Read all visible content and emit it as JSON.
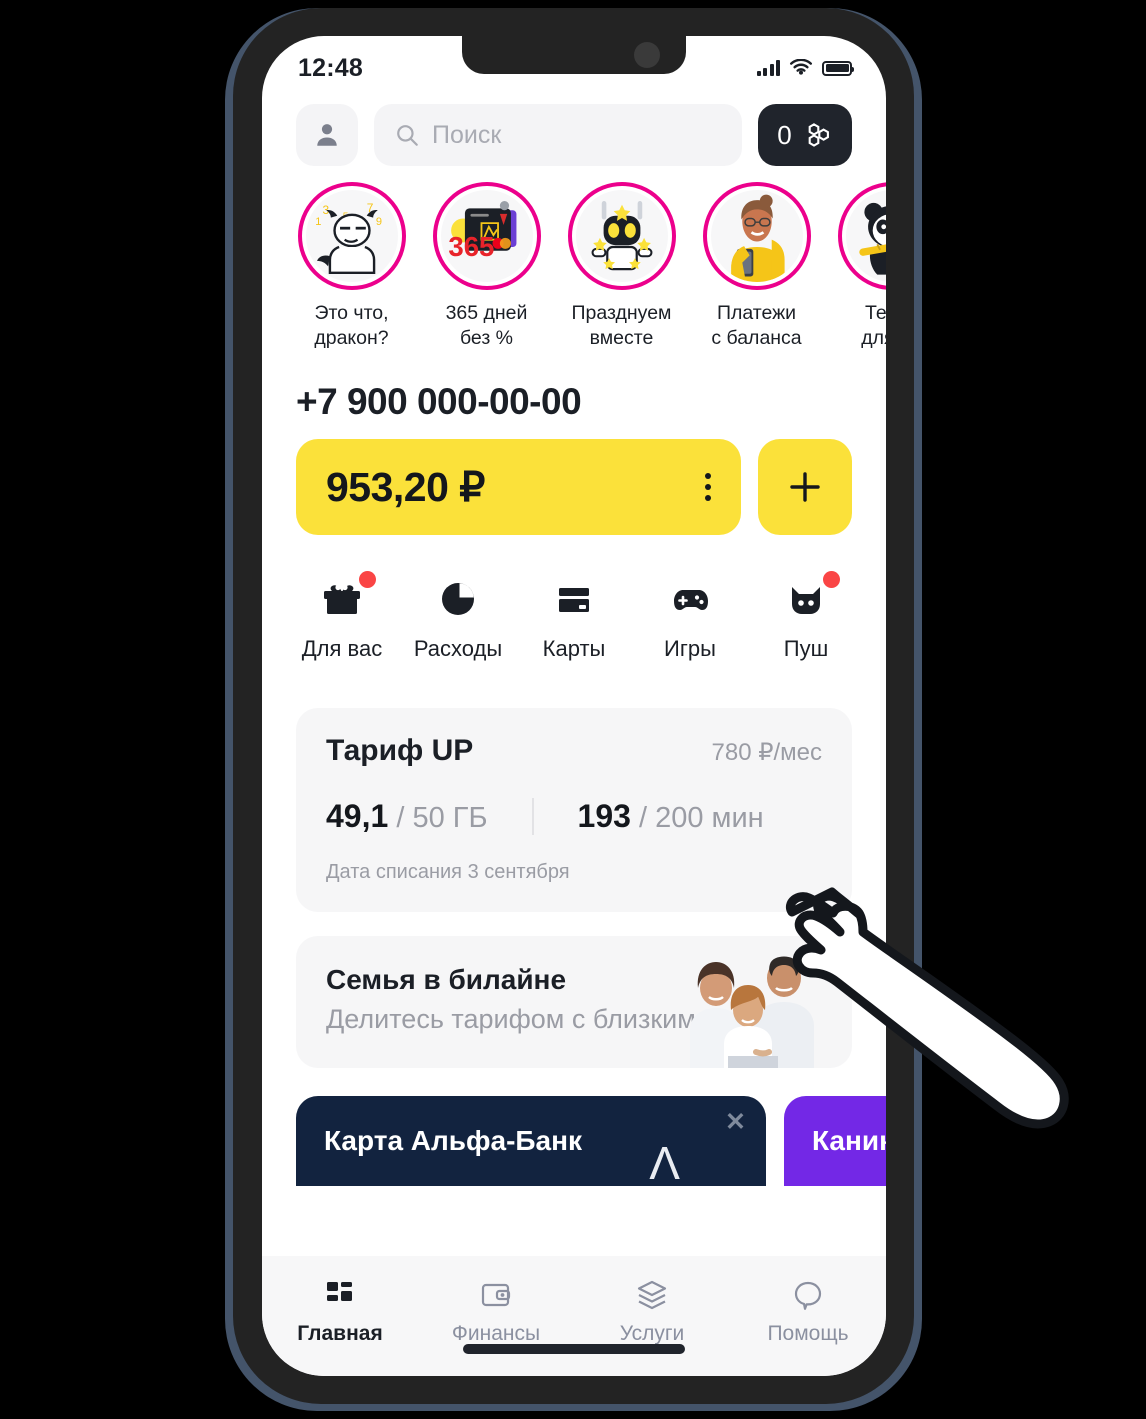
{
  "status_bar": {
    "time": "12:48",
    "signal_icon": "cellular-bars-icon",
    "wifi_icon": "wifi-icon",
    "battery_icon": "battery-icon"
  },
  "header": {
    "avatar_icon": "person-icon",
    "search": {
      "placeholder": "Поиск",
      "value": "",
      "icon": "search-icon"
    },
    "beads": {
      "count": "0",
      "icon": "honeycomb-icon"
    }
  },
  "stories": [
    {
      "caption": "Это что,\nдракон?",
      "thumb": "dragon-character"
    },
    {
      "caption": "365 дней\nбез %",
      "thumb": "bank-card-365"
    },
    {
      "caption": "Празднуем\nвместе",
      "thumb": "robot-stars"
    },
    {
      "caption": "Платежи\nс баланса",
      "thumb": "woman-yellow-sweater"
    },
    {
      "caption": "Телеc\nдля бл",
      "thumb": "panda-bamboo"
    }
  ],
  "account": {
    "msisdn": "+7 900 000-00-00",
    "balance": "953,20 ₽",
    "menu_icon": "kebab-menu-icon",
    "topup_icon": "plus-icon"
  },
  "quick_actions": [
    {
      "label": "Для вас",
      "icon": "gift-icon",
      "badge": true
    },
    {
      "label": "Расходы",
      "icon": "pie-chart-icon",
      "badge": false
    },
    {
      "label": "Карты",
      "icon": "credit-card-icon",
      "badge": false
    },
    {
      "label": "Игры",
      "icon": "gamepad-icon",
      "badge": false
    },
    {
      "label": "Пуш",
      "icon": "cat-icon",
      "badge": true
    }
  ],
  "tariff_card": {
    "title": "Тариф UP",
    "price": "780 ₽/мес",
    "data_used": "49,1",
    "data_total": "/ 50 ГБ",
    "minutes_used": "193",
    "minutes_total": "/ 200 мин",
    "note": "Дата списания 3 сентября"
  },
  "family_card": {
    "title": "Семья в билайне",
    "subtitle": "Делитесь тарифом с близкими",
    "image": "family-photo"
  },
  "promos": [
    {
      "title": "Карта Альфа-Банк",
      "close_icon": "close-icon",
      "logo": "alfa-bank-logo",
      "color": "#12233f"
    },
    {
      "title": "Каник",
      "color": "#7328e6"
    }
  ],
  "tabbar": [
    {
      "label": "Главная",
      "icon": "dashboard-icon",
      "active": true
    },
    {
      "label": "Финансы",
      "icon": "wallet-icon",
      "active": false
    },
    {
      "label": "Услуги",
      "icon": "layers-icon",
      "active": false
    },
    {
      "label": "Помощь",
      "icon": "chat-icon",
      "active": false
    }
  ],
  "cursor": {
    "icon": "pointing-hand-cursor"
  },
  "colors": {
    "brand_yellow": "#fbe13a",
    "brand_magenta": "#ec008c",
    "dark": "#1b1f26",
    "badge_red": "#fa4545",
    "muted": "#9a9ca4"
  }
}
